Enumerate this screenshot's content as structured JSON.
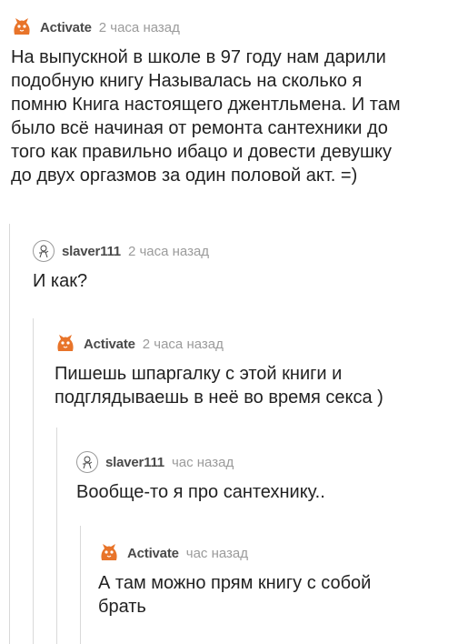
{
  "comments": [
    {
      "username": "Activate",
      "time": "2 часа назад",
      "avatar": "fox-icon",
      "text": "На выпускной в школе в 97 году нам дарили\nподобную книгу Называлась на сколько я\nпомню Книга настоящего джентльмена. И там\nбыло всё начиная от ремонта сантехники до\nтого как правильно ибацо и довести девушку\nдо двух оргазмов за один половой акт. =)"
    },
    {
      "username": "slaver111",
      "time": "2 часа назад",
      "avatar": "robot-sketch-icon",
      "text": "И как?"
    },
    {
      "username": "Activate",
      "time": "2 часа назад",
      "avatar": "fox-icon",
      "text": "Пишешь шпаргалку с этой книги и\nподглядываешь в неё во время секса )"
    },
    {
      "username": "slaver111",
      "time": "час назад",
      "avatar": "robot-sketch-icon",
      "text": "Вообще-то я про сантехнику.."
    },
    {
      "username": "Activate",
      "time": "час назад",
      "avatar": "fox-icon",
      "text": "А там можно прям книгу с собой\nбрать"
    }
  ],
  "colors": {
    "fox": "#e8742a",
    "username": "#4a4a4a",
    "time": "#9b9b9b",
    "thread_line": "#d9d9d9"
  }
}
